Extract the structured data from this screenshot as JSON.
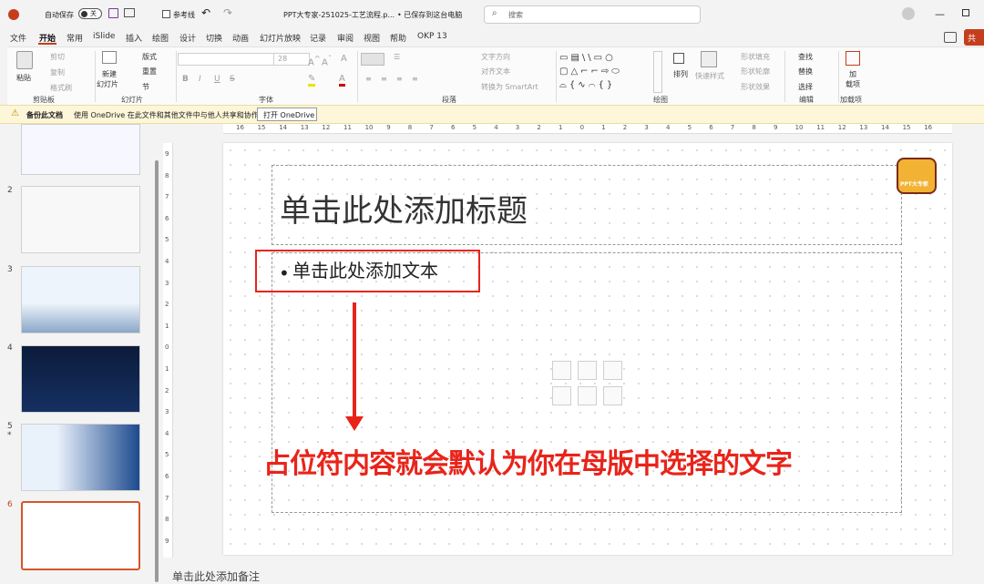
{
  "titlebar": {
    "autosave": "自动保存",
    "toggle_state": "关",
    "ref_line": "参考线",
    "doc_title": "PPT大专家-251025-工艺流程.p...",
    "saved_state": "• 已保存到这台电脑",
    "search_placeholder": "搜索"
  },
  "menu": {
    "items": [
      "文件",
      "开始",
      "常用",
      "iSlide",
      "插入",
      "绘图",
      "设计",
      "切换",
      "动画",
      "幻灯片放映",
      "记录",
      "审阅",
      "视图",
      "帮助",
      "OKP 13"
    ],
    "share": "共"
  },
  "ribbon": {
    "clipboard": {
      "paste": "粘贴",
      "cut": "剪切",
      "copy": "复制",
      "format_painter": "格式刷",
      "label": "剪贴板"
    },
    "slides": {
      "new_slide": "新建",
      "new_slide2": "幻灯片",
      "layout": "版式",
      "reset": "重置",
      "section": "节",
      "label": "幻灯片"
    },
    "font": {
      "size": "28",
      "bold": "B",
      "italic": "I",
      "underline": "U",
      "strike": "S",
      "label": "字体"
    },
    "paragraph": {
      "text_direction": "文字方向",
      "align_text": "对齐文本",
      "smartart": "转换为 SmartArt",
      "label": "段落"
    },
    "drawing": {
      "arrange": "排列",
      "quick_styles": "快速样式",
      "shape_fill": "形状填充",
      "shape_outline": "形状轮廓",
      "shape_effects": "形状效果",
      "label": "绘图"
    },
    "editing": {
      "find": "查找",
      "replace": "替换",
      "select": "选择",
      "label": "编辑"
    },
    "addins": {
      "addin_line1": "加",
      "addin_line2": "载项",
      "label": "加载项"
    }
  },
  "infobar": {
    "title": "备份此文档",
    "message": "使用 OneDrive 在此文件和其他文件中与他人共享和协作。",
    "button": "打开 OneDrive"
  },
  "thumbnails": {
    "numbers": [
      "2",
      "3",
      "4",
      "5",
      "6"
    ],
    "star": "*"
  },
  "ruler_h": [
    "16",
    "15",
    "14",
    "13",
    "12",
    "11",
    "10",
    "9",
    "8",
    "7",
    "6",
    "5",
    "4",
    "3",
    "2",
    "1",
    "0",
    "1",
    "2",
    "3",
    "4",
    "5",
    "6",
    "7",
    "8",
    "9",
    "10",
    "11",
    "12",
    "13",
    "14",
    "15",
    "16"
  ],
  "ruler_v": [
    "9",
    "8",
    "7",
    "6",
    "5",
    "4",
    "3",
    "2",
    "1",
    "0",
    "1",
    "2",
    "3",
    "4",
    "5",
    "6",
    "7",
    "8",
    "9"
  ],
  "slide": {
    "title_placeholder": "单击此处添加标题",
    "body_placeholder": "单击此处添加文本",
    "annotation": "占位符内容就会默认为你在母版中选择的文字",
    "logo_text": "PPT大专家"
  },
  "notes": {
    "placeholder": "单击此处添加备注"
  },
  "colors": {
    "accent": "#c43e1c",
    "annotation_red": "#e8241a",
    "info_bg": "#fdf6d8"
  }
}
